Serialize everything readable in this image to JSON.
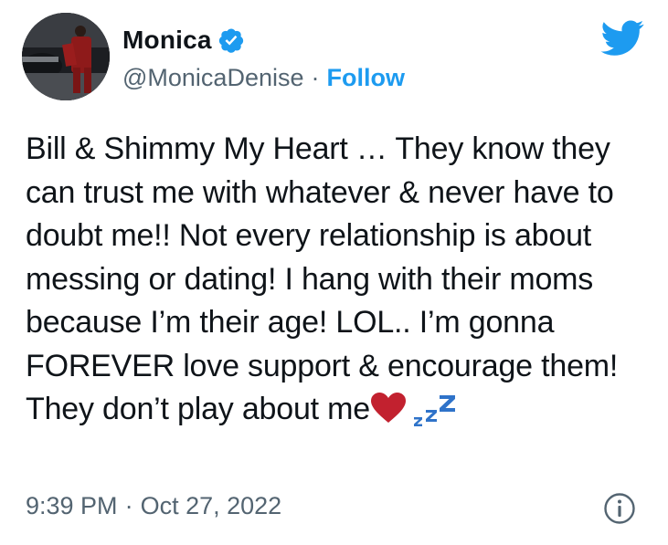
{
  "author": {
    "display_name": "Monica",
    "handle": "@MonicaDenise",
    "separator": "·",
    "follow_label": "Follow",
    "verified": true
  },
  "tweet": {
    "text": "Bill & Shimmy My Heart … They know they can trust me with whatever & never have to doubt me!! Not every relationship is about messing or dating! I hang with their moms because I’m their age! LOL.. I’m gonna FOREVER love support & encourage them! They don’t play about me",
    "emojis": [
      "heart",
      "zzz"
    ]
  },
  "meta": {
    "time": "9:39 PM",
    "separator": "·",
    "date": "Oct 27, 2022"
  },
  "icons": {
    "brand": "twitter-bird-icon",
    "verified": "verified-badge-icon",
    "info": "info-icon"
  },
  "colors": {
    "accent": "#1d9bf0",
    "text": "#0f1419",
    "secondary": "#536471",
    "heart": "#c2212f"
  }
}
